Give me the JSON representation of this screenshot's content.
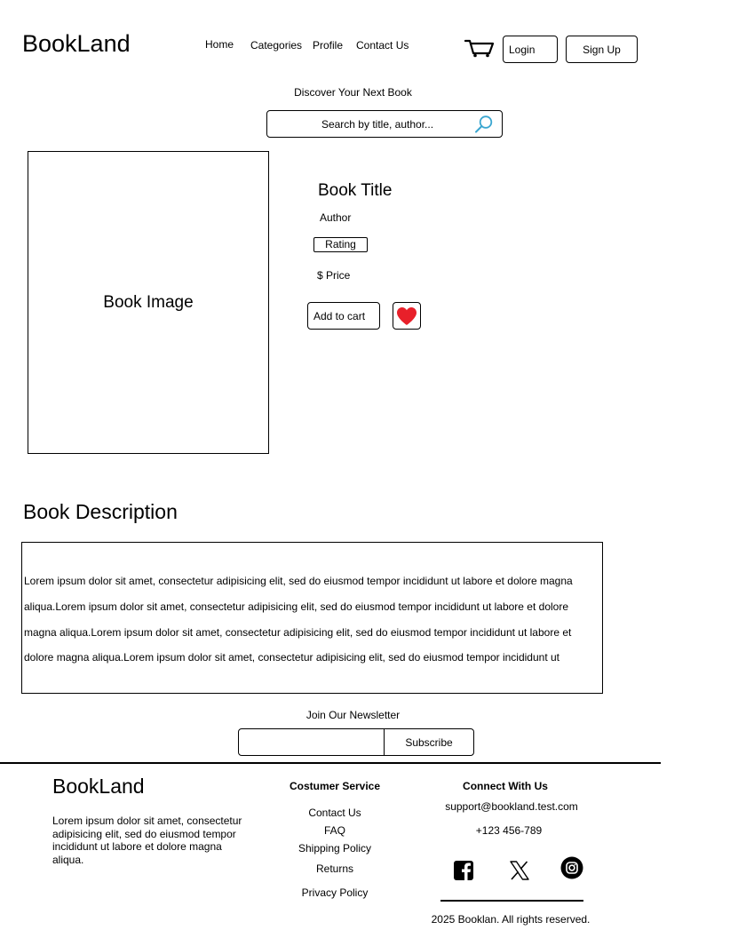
{
  "header": {
    "logo": "BookLand",
    "nav": [
      "Home",
      "Categories",
      "Profile",
      "Contact Us"
    ],
    "login_label": "Login",
    "signup_label": "Sign Up"
  },
  "hero": {
    "tagline": "Discover Your Next Book",
    "search_placeholder": "Search by title, author..."
  },
  "product": {
    "image_label": "Book Image",
    "title": "Book Title",
    "author": "Author",
    "rating_label": "Rating",
    "price": "$ Price",
    "add_to_cart_label": "Add to cart"
  },
  "description": {
    "heading": "Book Description",
    "text": "Lorem ipsum dolor sit amet, consectetur adipisicing elit, sed do eiusmod tempor incididunt ut labore et dolore magna aliqua.Lorem ipsum dolor sit amet, consectetur adipisicing elit, sed do eiusmod tempor incididunt ut labore et dolore magna aliqua.Lorem ipsum dolor sit amet, consectetur adipisicing elit, sed do eiusmod tempor incididunt ut labore et dolore magna aliqua.Lorem ipsum dolor sit amet, consectetur adipisicing elit, sed do eiusmod tempor incididunt ut"
  },
  "newsletter": {
    "heading": "Join Our Newsletter",
    "subscribe_label": "Subscribe"
  },
  "footer": {
    "logo": "BookLand",
    "about": "Lorem ipsum dolor sit amet, consectetur adipisicing elit, sed do eiusmod tempor incididunt ut labore et dolore magna aliqua.",
    "service_heading": "Costumer Service",
    "service_links": [
      "Contact Us",
      "FAQ",
      "Shipping Policy",
      "Returns",
      "Privacy Policy"
    ],
    "connect_heading": "Connect With Us",
    "email": "support@bookland.test.com",
    "phone": "+123 456-789",
    "social_icons": [
      "facebook-icon",
      "x-icon",
      "instagram-icon"
    ],
    "copyright": "2025 Booklan. All rights reserved."
  },
  "colors": {
    "heart": "#e8202a",
    "search_icon": "#3aa6d0"
  }
}
